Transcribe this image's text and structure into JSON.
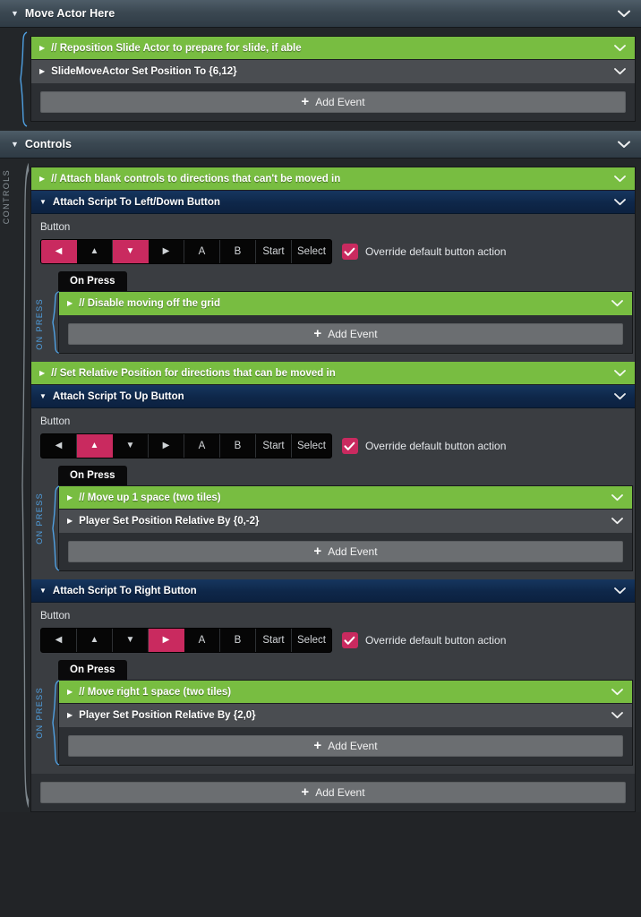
{
  "app": {
    "plus_icon": "plus-icon",
    "chevron_icon": "chevron-down-icon",
    "triangle_open": "▼",
    "triangle_closed": "▶",
    "colors": {
      "comment_green": "#78bd41",
      "accent_pink": "#c92a5f",
      "attach_blue": "#0e2749",
      "header_slate": "#3b4852",
      "row_gray": "#4a4d51",
      "panel_dark": "#2c2f33",
      "rail_blue": "#4f9fe0",
      "rail_gray": "#8a9399"
    }
  },
  "sections": [
    {
      "id": "move-actor-here",
      "title": "Move Actor Here",
      "rows": [
        {
          "kind": "comment",
          "text": "// Reposition Slide Actor to prepare for slide, if able",
          "open": false
        },
        {
          "kind": "normal",
          "text": "SlideMoveActor Set Position To {6,12}",
          "open": false
        }
      ],
      "add_event_label": "Add Event"
    },
    {
      "id": "controls",
      "title": "Controls",
      "rail_label": "CONTROLS",
      "add_event_label": "Add Event",
      "items": [
        {
          "kind": "comment",
          "text": "// Attach blank controls to directions that can't be moved in"
        },
        {
          "kind": "attach",
          "title": "Attach Script To Left/Down Button",
          "field_label": "Button",
          "buttons": [
            {
              "name": "left",
              "glyph": "◀",
              "selected": true
            },
            {
              "name": "up",
              "glyph": "▲",
              "selected": false
            },
            {
              "name": "down",
              "glyph": "▼",
              "selected": true
            },
            {
              "name": "right",
              "glyph": "▶",
              "selected": false
            },
            {
              "name": "a",
              "glyph": "A",
              "selected": false
            },
            {
              "name": "b",
              "glyph": "B",
              "selected": false
            },
            {
              "name": "start",
              "glyph": "Start",
              "selected": false
            },
            {
              "name": "select",
              "glyph": "Select",
              "selected": false
            }
          ],
          "override_label": "Override default button action",
          "override_checked": true,
          "tab_label": "On Press",
          "rail_label": "ON PRESS",
          "rows": [
            {
              "kind": "comment",
              "text": "// Disable moving off the grid"
            }
          ],
          "add_event_label": "Add Event"
        },
        {
          "kind": "comment",
          "text": "// Set Relative Position for directions that can be moved in"
        },
        {
          "kind": "attach",
          "title": "Attach Script To Up Button",
          "field_label": "Button",
          "buttons": [
            {
              "name": "left",
              "glyph": "◀",
              "selected": false
            },
            {
              "name": "up",
              "glyph": "▲",
              "selected": true
            },
            {
              "name": "down",
              "glyph": "▼",
              "selected": false
            },
            {
              "name": "right",
              "glyph": "▶",
              "selected": false
            },
            {
              "name": "a",
              "glyph": "A",
              "selected": false
            },
            {
              "name": "b",
              "glyph": "B",
              "selected": false
            },
            {
              "name": "start",
              "glyph": "Start",
              "selected": false
            },
            {
              "name": "select",
              "glyph": "Select",
              "selected": false
            }
          ],
          "override_label": "Override default button action",
          "override_checked": true,
          "tab_label": "On Press",
          "rail_label": "ON PRESS",
          "rows": [
            {
              "kind": "comment",
              "text": "// Move up 1 space (two tiles)"
            },
            {
              "kind": "normal",
              "text": "Player Set Position Relative By {0,-2}"
            }
          ],
          "add_event_label": "Add Event"
        },
        {
          "kind": "attach",
          "title": "Attach Script To Right Button",
          "field_label": "Button",
          "buttons": [
            {
              "name": "left",
              "glyph": "◀",
              "selected": false
            },
            {
              "name": "up",
              "glyph": "▲",
              "selected": false
            },
            {
              "name": "down",
              "glyph": "▼",
              "selected": false
            },
            {
              "name": "right",
              "glyph": "▶",
              "selected": true
            },
            {
              "name": "a",
              "glyph": "A",
              "selected": false
            },
            {
              "name": "b",
              "glyph": "B",
              "selected": false
            },
            {
              "name": "start",
              "glyph": "Start",
              "selected": false
            },
            {
              "name": "select",
              "glyph": "Select",
              "selected": false
            }
          ],
          "override_label": "Override default button action",
          "override_checked": true,
          "tab_label": "On Press",
          "rail_label": "ON PRESS",
          "rows": [
            {
              "kind": "comment",
              "text": "// Move right 1 space (two tiles)"
            },
            {
              "kind": "normal",
              "text": "Player Set Position Relative By {2,0}"
            }
          ],
          "add_event_label": "Add Event"
        }
      ]
    }
  ]
}
